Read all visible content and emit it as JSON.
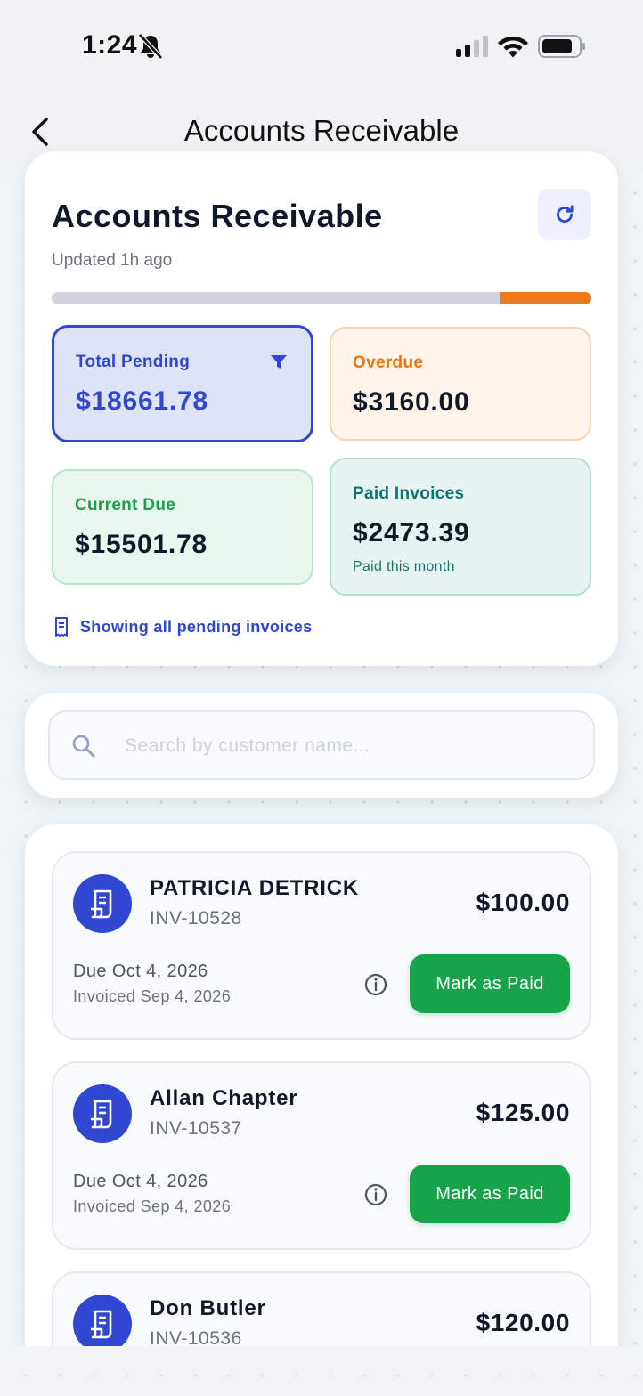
{
  "status_bar": {
    "time": "1:24"
  },
  "nav": {
    "title": "Accounts Receivable"
  },
  "summary": {
    "title": "Accounts Receivable",
    "updated": "Updated 1h ago",
    "overdue_fraction": 0.17,
    "stats": {
      "total_pending": {
        "label": "Total Pending",
        "value": "$18661.78"
      },
      "overdue": {
        "label": "Overdue",
        "value": "$3160.00"
      },
      "current_due": {
        "label": "Current Due",
        "value": "$15501.78"
      },
      "paid": {
        "label": "Paid Invoices",
        "value": "$2473.39",
        "sub": "Paid this month"
      }
    },
    "showing": "Showing all pending invoices"
  },
  "search": {
    "placeholder": "Search by customer name..."
  },
  "invoices": [
    {
      "name": "PATRICIA DETRICK",
      "number": "INV-10528",
      "amount": "$100.00",
      "due": "Due Oct 4, 2026",
      "invoiced": "Invoiced Sep 4, 2026",
      "action": "Mark as Paid"
    },
    {
      "name": "Allan Chapter",
      "number": "INV-10537",
      "amount": "$125.00",
      "due": "Due Oct 4, 2026",
      "invoiced": "Invoiced Sep 4, 2026",
      "action": "Mark as Paid"
    },
    {
      "name": "Don Butler",
      "number": "INV-10536",
      "amount": "$120.00"
    }
  ],
  "colors": {
    "accent": "#2f47d1",
    "overdue": "#ea7317",
    "current": "#16a34a",
    "paid": "#0f766e"
  },
  "icons": [
    "back-icon",
    "bell-muted-icon",
    "signal-icon",
    "wifi-icon",
    "battery-icon",
    "refresh-icon",
    "filter-icon",
    "receipt-icon",
    "search-icon",
    "info-icon"
  ]
}
